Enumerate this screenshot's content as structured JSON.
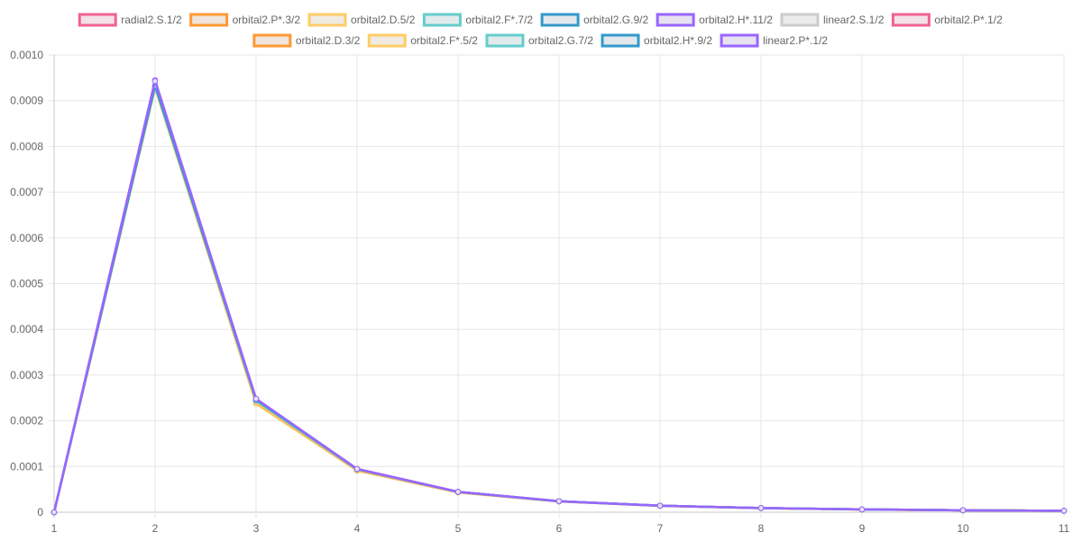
{
  "chart_data": {
    "type": "line",
    "x": [
      1,
      2,
      3,
      4,
      5,
      6,
      7,
      8,
      9,
      10,
      11
    ],
    "ylim": [
      0,
      0.001
    ],
    "y_ticks": [
      "0",
      "0.0001",
      "0.0002",
      "0.0003",
      "0.0004",
      "0.0005",
      "0.0006",
      "0.0007",
      "0.0008",
      "0.0009",
      "0.0010"
    ],
    "x_ticks": [
      "1",
      "2",
      "3",
      "4",
      "5",
      "6",
      "7",
      "8",
      "9",
      "10",
      "11"
    ],
    "grid": true,
    "legend_position": "top-center",
    "series": [
      {
        "name": "radial2.S.1/2",
        "color": "#f06292",
        "fill": "#f2e1e6",
        "values": [
          0,
          0.000932,
          0.000246,
          9.45e-05,
          4.45e-05,
          2.4e-05,
          1.43e-05,
          9.1e-06,
          6.1e-06,
          4.3e-06,
          3.1e-06
        ]
      },
      {
        "name": "orbital2.P*.3/2",
        "color": "#ff9933",
        "fill": "#efe5dc",
        "values": [
          0,
          0.000929,
          0.000239,
          9.15e-05,
          4.35e-05,
          2.36e-05,
          1.41e-05,
          9e-06,
          6e-06,
          4.2e-06,
          3.1e-06
        ]
      },
      {
        "name": "orbital2.D.5/2",
        "color": "#ffcc66",
        "fill": "#efebe3",
        "values": [
          0,
          0.000928,
          0.000237,
          9.1e-05,
          4.32e-05,
          2.35e-05,
          1.4e-05,
          8.9e-06,
          6e-06,
          4.2e-06,
          3e-06
        ]
      },
      {
        "name": "orbital2.F*.7/2",
        "color": "#66cccc",
        "fill": "#e2ebeb",
        "values": [
          0,
          0.000931,
          0.000243,
          9.35e-05,
          4.42e-05,
          2.39e-05,
          1.42e-05,
          9e-06,
          6.1e-06,
          4.3e-06,
          3.1e-06
        ]
      },
      {
        "name": "orbital2.G.9/2",
        "color": "#3399cc",
        "fill": "#e3e8ec",
        "values": [
          0,
          0.000933,
          0.000245,
          9.42e-05,
          4.44e-05,
          2.4e-05,
          1.43e-05,
          9.1e-06,
          6.1e-06,
          4.3e-06,
          3.1e-06
        ]
      },
      {
        "name": "orbital2.H*.11/2",
        "color": "#9966ff",
        "fill": "#e7e2f0",
        "values": [
          0,
          0.000945,
          0.000248,
          9.48e-05,
          4.46e-05,
          2.41e-05,
          1.43e-05,
          9.1e-06,
          6.1e-06,
          4.3e-06,
          3.1e-06
        ]
      },
      {
        "name": "linear2.S.1/2",
        "color": "#cccccc",
        "fill": "#ebebeb",
        "values": [
          0,
          0.000932,
          0.000246,
          9.45e-05,
          4.45e-05,
          2.4e-05,
          1.43e-05,
          9.1e-06,
          6.1e-06,
          4.3e-06,
          3.1e-06
        ]
      },
      {
        "name": "orbital2.P*.1/2",
        "color": "#f06292",
        "fill": "#f2e1e6",
        "values": [
          0,
          0.000932,
          0.000247,
          9.46e-05,
          4.45e-05,
          2.4e-05,
          1.43e-05,
          9.1e-06,
          6.1e-06,
          4.3e-06,
          3.1e-06
        ]
      },
      {
        "name": "orbital2.D.3/2",
        "color": "#ff9933",
        "fill": "#efe5dc",
        "values": [
          0,
          0.000931,
          0.000241,
          9.2e-05,
          4.37e-05,
          2.37e-05,
          1.41e-05,
          9e-06,
          6e-06,
          4.2e-06,
          3.1e-06
        ]
      },
      {
        "name": "orbital2.F*.5/2",
        "color": "#ffcc66",
        "fill": "#efebe3",
        "values": [
          0,
          0.00093,
          0.000242,
          9.28e-05,
          4.4e-05,
          2.38e-05,
          1.42e-05,
          9e-06,
          6.1e-06,
          4.3e-06,
          3.1e-06
        ]
      },
      {
        "name": "orbital2.G.7/2",
        "color": "#66cccc",
        "fill": "#e2ebeb",
        "values": [
          0,
          0.000932,
          0.000244,
          9.38e-05,
          4.43e-05,
          2.4e-05,
          1.43e-05,
          9.1e-06,
          6.1e-06,
          4.3e-06,
          3.1e-06
        ]
      },
      {
        "name": "orbital2.H*.9/2",
        "color": "#3399cc",
        "fill": "#e3e8ec",
        "values": [
          0,
          0.000933,
          0.000246,
          9.43e-05,
          4.45e-05,
          2.4e-05,
          1.43e-05,
          9.1e-06,
          6.1e-06,
          4.3e-06,
          3.1e-06
        ]
      },
      {
        "name": "linear2.P*.1/2",
        "color": "#9966ff",
        "fill": "#e7e2f0",
        "values": [
          0,
          0.000943,
          0.000248,
          9.47e-05,
          4.46e-05,
          2.41e-05,
          1.43e-05,
          9.1e-06,
          6.1e-06,
          4.3e-06,
          3.1e-06
        ]
      }
    ]
  }
}
